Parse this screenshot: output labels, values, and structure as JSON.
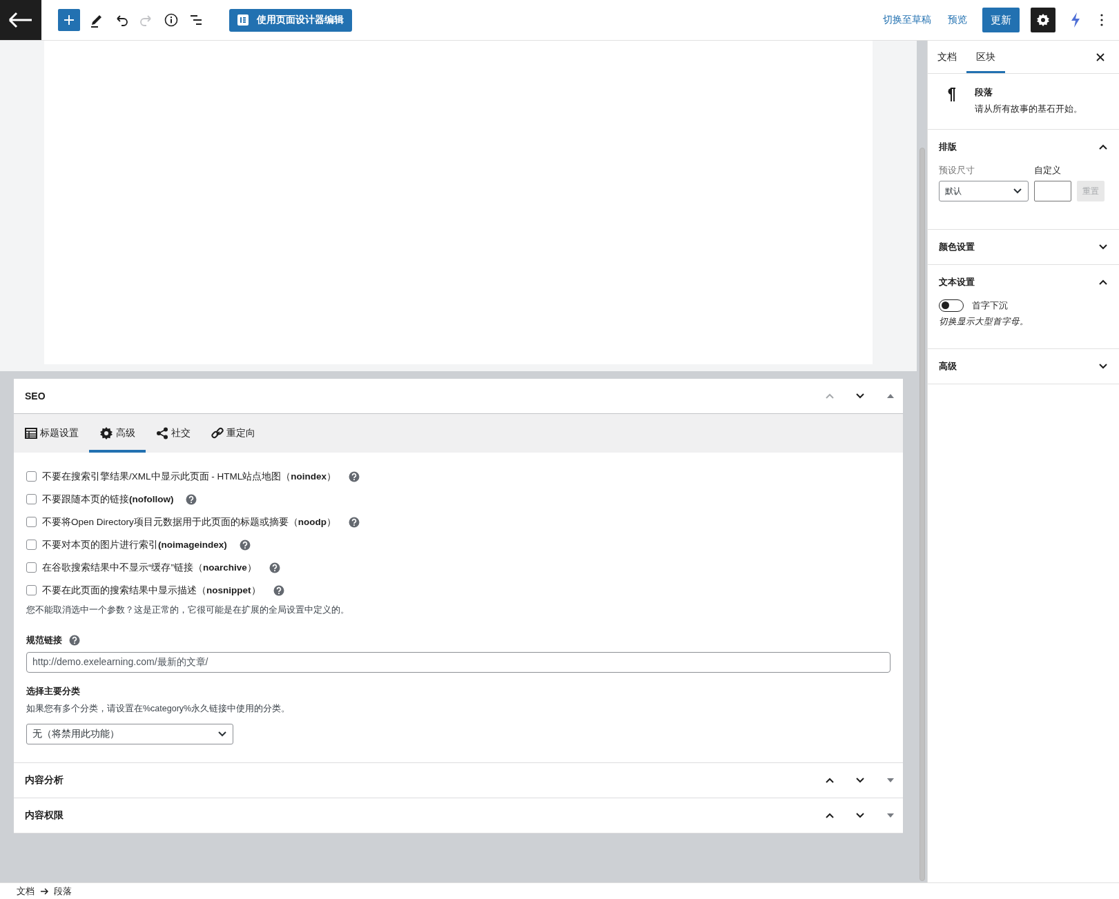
{
  "toolbar": {
    "tools": [
      {
        "kind": "add",
        "disabled": false
      },
      {
        "kind": "edit",
        "disabled": false
      },
      {
        "kind": "undo",
        "disabled": false
      },
      {
        "kind": "redo",
        "disabled": true
      },
      {
        "kind": "info",
        "disabled": false
      },
      {
        "kind": "outline",
        "disabled": false
      }
    ],
    "designer_button": "使用页面设计器编辑",
    "switch_to_draft": "切换至草稿",
    "preview": "预览",
    "update": "更新",
    "settings_selected": true
  },
  "metaboxes": [
    {
      "kind": "seo",
      "title": "SEO",
      "expanded": true,
      "can_move_up": false,
      "tabs": [
        {
          "label": "标题设置",
          "selected": false
        },
        {
          "label": "高级",
          "selected": true
        },
        {
          "label": "社交",
          "selected": false
        },
        {
          "label": "重定向",
          "selected": false
        }
      ],
      "options": [
        {
          "label": "不要在搜索引擎结果/XML中显示此页面 - HTML站点地图（**noindex**）",
          "checked": false
        },
        {
          "label": "不要跟随本页的链接**(nofollow)**",
          "checked": false
        },
        {
          "label": "不要将Open Directory项目元数据用于此页面的标题或摘要（**noodp**）",
          "checked": false
        },
        {
          "label": "不要对本页的图片进行索引**(noimageindex)**",
          "checked": false
        },
        {
          "label": "在谷歌搜索结果中不显示“缓存”链接（**noarchive**）",
          "checked": false
        },
        {
          "label": "不要在此页面的搜索结果中显示描述（**nosnippet**）",
          "checked": false
        }
      ],
      "note": "您不能取消选中一个参数？这是正常的，它很可能是在扩展的全局设置中定义的。",
      "canonical": {
        "label": "规范链接",
        "value": "http://demo.exelearning.com/最新的文章/"
      },
      "primary_category": {
        "label": "选择主要分类",
        "description": "如果您有多个分类，请设置在%category%永久链接中使用的分类。",
        "value": "无（将禁用此功能）"
      }
    },
    {
      "kind": "plain",
      "title": "内容分析",
      "expanded": false,
      "can_move_up": true
    },
    {
      "kind": "plain",
      "title": "内容权限",
      "expanded": false,
      "can_move_up": true
    }
  ],
  "sidebar": {
    "tabs": [
      {
        "label": "文档",
        "selected": false
      },
      {
        "label": "区块",
        "selected": true
      }
    ],
    "block": {
      "title": "段落",
      "description": "请从所有故事的基石开始。"
    },
    "panels": [
      {
        "kind": "typography",
        "title": "排版",
        "expanded": true,
        "preset_label": "预设尺寸",
        "preset_value": "默认",
        "custom_label": "自定义",
        "reset": "重置"
      },
      {
        "kind": "plain",
        "title": "颜色设置",
        "expanded": false
      },
      {
        "kind": "toggle",
        "title": "文本设置",
        "expanded": true,
        "toggle_label": "首字下沉",
        "on": false,
        "help": "切换显示大型首字母。"
      },
      {
        "kind": "plain",
        "title": "高级",
        "expanded": false
      }
    ]
  },
  "breadcrumb": [
    "文档",
    "段落"
  ]
}
